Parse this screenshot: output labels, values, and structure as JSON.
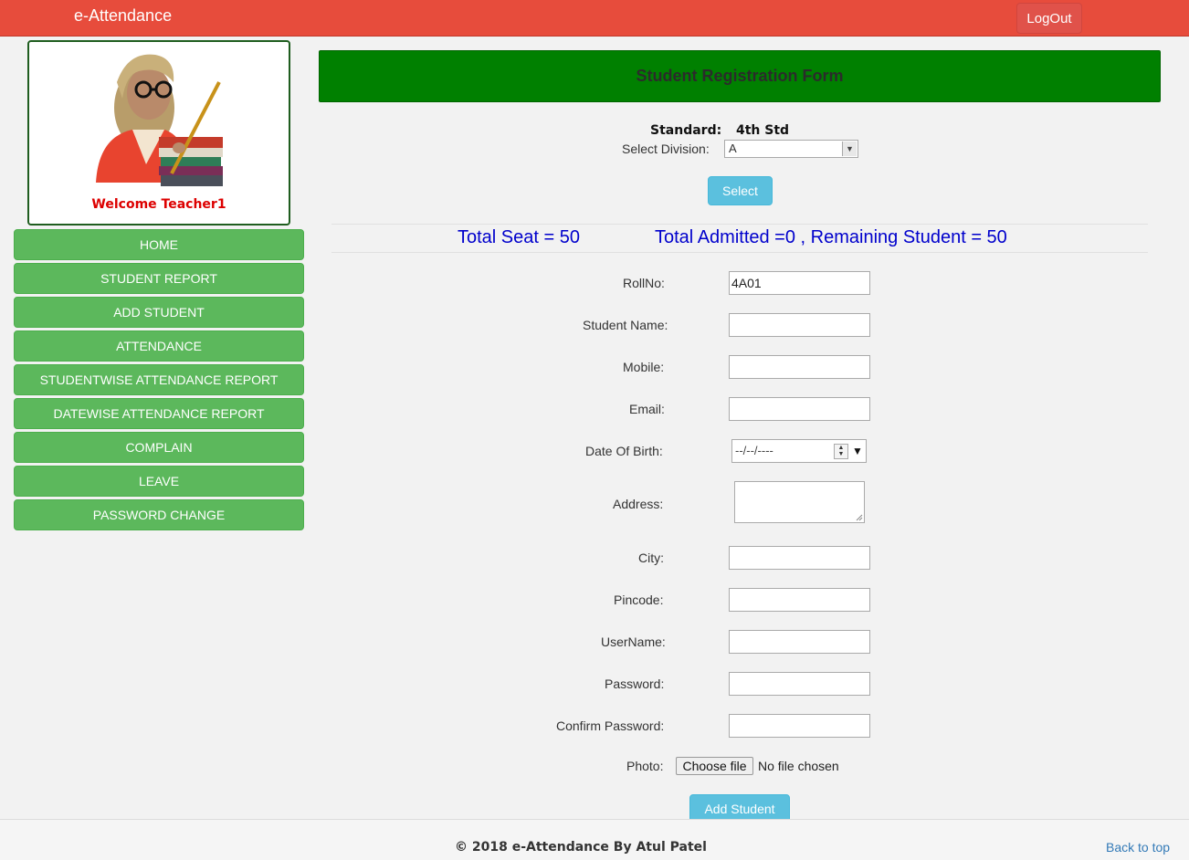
{
  "app": {
    "brand": "e-Attendance",
    "logout_label": "LogOut"
  },
  "profile": {
    "avatar_icon": "teacher-icon",
    "welcome": "Welcome Teacher1"
  },
  "nav": {
    "items": [
      "HOME",
      "STUDENT REPORT",
      "ADD STUDENT",
      "ATTENDANCE",
      "STUDENTWISE ATTENDANCE REPORT",
      "DATEWISE ATTENDANCE REPORT",
      "COMPLAIN",
      "LEAVE",
      "PASSWORD CHANGE"
    ]
  },
  "form": {
    "title": "Student Registration Form",
    "standard_label": "Standard:",
    "standard_value": "4th Std",
    "division_label": "Select Division:",
    "division_value": "A",
    "select_button": "Select",
    "total_seat": "Total Seat = 50",
    "admitted_summary": "Total Admitted =0 , Remaining Student = 50",
    "fields": {
      "rollno": {
        "label": "RollNo:",
        "value": "4A01"
      },
      "student_name": {
        "label": "Student Name:",
        "value": ""
      },
      "mobile": {
        "label": "Mobile:",
        "value": ""
      },
      "email": {
        "label": "Email:",
        "value": ""
      },
      "dob": {
        "label": "Date Of Birth:",
        "placeholder": "--/--/----"
      },
      "address": {
        "label": "Address:",
        "value": ""
      },
      "city": {
        "label": "City:",
        "value": ""
      },
      "pincode": {
        "label": "Pincode:",
        "value": ""
      },
      "username": {
        "label": "UserName:",
        "value": ""
      },
      "password": {
        "label": "Password:",
        "value": ""
      },
      "confirm_password": {
        "label": "Confirm Password:",
        "value": ""
      },
      "photo": {
        "label": "Photo:",
        "button": "Choose file",
        "status": "No file chosen"
      }
    },
    "add_button": "Add Student"
  },
  "footer": {
    "copyright": "© 2018 e-Attendance By Atul Patel",
    "back_to_top": "Back to top"
  },
  "colors": {
    "topbar": "#e74c3c",
    "nav_button": "#5cb85c",
    "header_green": "#008000",
    "info_button": "#5bc0de",
    "seat_text": "#0000cc",
    "welcome_text": "#dd0000"
  }
}
